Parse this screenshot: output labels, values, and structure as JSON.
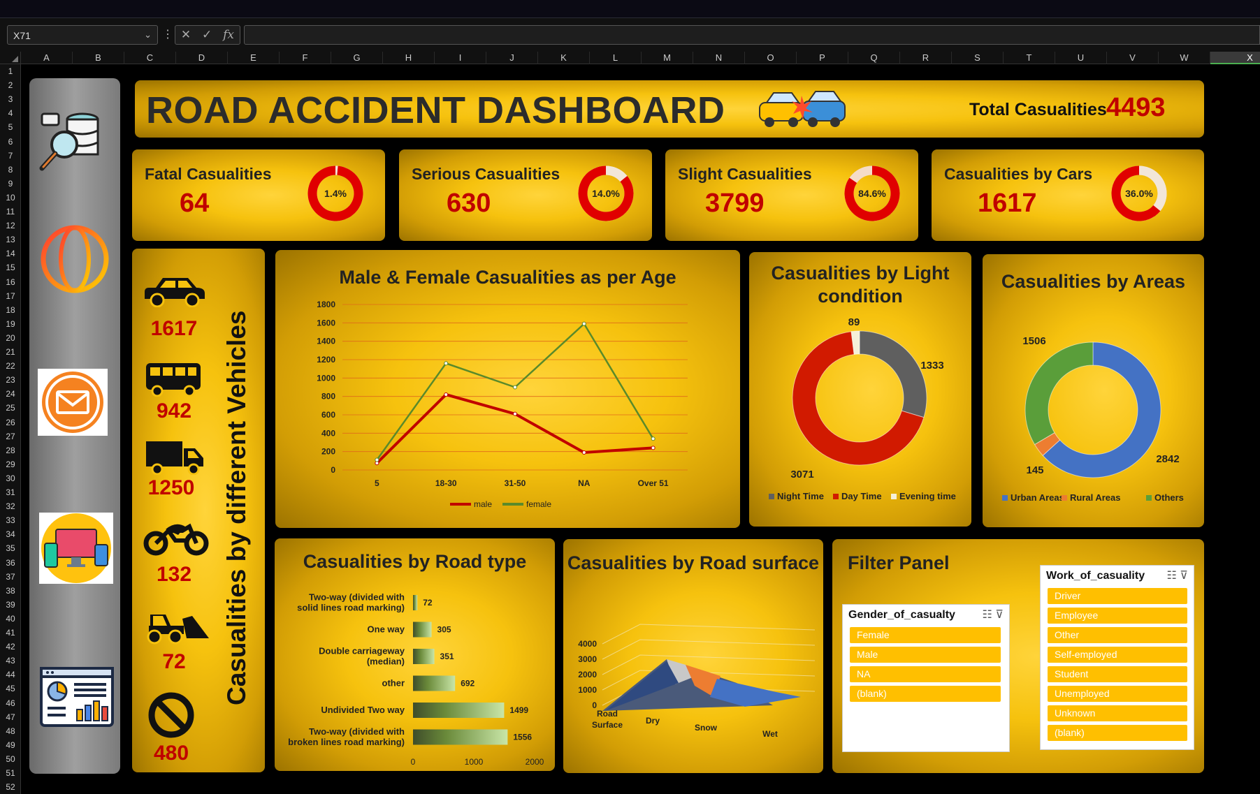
{
  "excel": {
    "name_box": "X71",
    "formula_icons": [
      "cancel-icon",
      "check-icon",
      "fx-icon"
    ],
    "columns": [
      "A",
      "B",
      "C",
      "D",
      "E",
      "F",
      "G",
      "H",
      "I",
      "J",
      "K",
      "L",
      "M",
      "N",
      "O",
      "P",
      "Q",
      "R",
      "S",
      "T",
      "U",
      "V",
      "W",
      "X"
    ],
    "selected_column": "X",
    "rows": [
      "1",
      "2",
      "3",
      "4",
      "5",
      "6",
      "7",
      "8",
      "9",
      "10",
      "11",
      "12",
      "13",
      "14",
      "15",
      "16",
      "17",
      "18",
      "19",
      "20",
      "21",
      "22",
      "23",
      "24",
      "25",
      "26",
      "27",
      "28",
      "29",
      "30",
      "31",
      "32",
      "33",
      "34",
      "35",
      "36",
      "37",
      "38",
      "39",
      "40",
      "41",
      "42",
      "43",
      "44",
      "45",
      "46",
      "47",
      "48",
      "49",
      "50",
      "51",
      "52"
    ]
  },
  "sidebar_icons": [
    "database-search-icon",
    "globe-icon",
    "mail-icon",
    "devices-icon",
    "dashboard-report-icon"
  ],
  "header": {
    "title": "ROAD ACCIDENT DASHBOARD",
    "total_label": "Total Casualities",
    "total_value": "4493"
  },
  "kpis": [
    {
      "label": "Fatal Casualities",
      "value": "64",
      "pct": "1.4%",
      "fraction": 0.014
    },
    {
      "label": "Serious Casualities",
      "value": "630",
      "pct": "14.0%",
      "fraction": 0.14
    },
    {
      "label": "Slight Casualities",
      "value": "3799",
      "pct": "84.6%",
      "fraction": 0.846
    },
    {
      "label": "Casualities by Cars",
      "value": "1617",
      "pct": "36.0%",
      "fraction": 0.36
    }
  ],
  "vehicles": {
    "title": "Casualities by different Vehicles",
    "items": [
      {
        "icon": "car-icon",
        "value": "1617"
      },
      {
        "icon": "bus-icon",
        "value": "942"
      },
      {
        "icon": "truck-icon",
        "value": "1250"
      },
      {
        "icon": "motorcycle-icon",
        "value": "132"
      },
      {
        "icon": "tractor-icon",
        "value": "72"
      },
      {
        "icon": "prohibited-icon",
        "value": "480"
      }
    ]
  },
  "age_chart_title": "Male & Female Casualities as per Age",
  "light_chart_title": "Casualities by Light condition",
  "area_chart_title": "Casualities by Areas",
  "roadtype_chart_title": "Casualities by Road type",
  "surface_chart_title": "Casualities by Road surface",
  "chart_data": [
    {
      "type": "line",
      "title": "Male & Female Casualities as per Age",
      "categories": [
        "5",
        "18-30",
        "31-50",
        "NA",
        "Over 51"
      ],
      "series": [
        {
          "name": "male",
          "values": [
            75,
            820,
            610,
            190,
            240
          ],
          "color": "#c00000"
        },
        {
          "name": "female",
          "values": [
            110,
            1160,
            900,
            1590,
            340
          ],
          "color": "#5a8a2a"
        }
      ],
      "yticks": [
        "0",
        "200",
        "400",
        "600",
        "800",
        "1000",
        "1200",
        "1400",
        "1600",
        "1800"
      ],
      "ylim": [
        0,
        1800
      ]
    },
    {
      "type": "pie",
      "title": "Casualities by Light condition",
      "labels": [
        "Night Time",
        "Day Time",
        "Evening time"
      ],
      "values": [
        1333,
        3071,
        89
      ],
      "value_labels": [
        "1333",
        "3071",
        "89"
      ],
      "colors": [
        "#5f5f5f",
        "#d11a00",
        "#f5f0d8"
      ]
    },
    {
      "type": "pie",
      "title": "Casualities by Areas",
      "labels": [
        "Urban Areas",
        "Rural Areas",
        "Others"
      ],
      "values": [
        2842,
        145,
        1506
      ],
      "value_labels": [
        "2842",
        "145",
        "1506"
      ],
      "colors": [
        "#4472c4",
        "#ed7d31",
        "#5a9e3a"
      ]
    },
    {
      "type": "bar",
      "title": "Casualities by Road type",
      "categories": [
        [
          "Two-way (divided with",
          "solid lines road marking)"
        ],
        [
          "One way"
        ],
        [
          "Double carriageway",
          "(median)"
        ],
        [
          "other"
        ],
        [
          "Undivided Two way"
        ],
        [
          "Two-way (divided with",
          "broken lines road marking)"
        ]
      ],
      "values": [
        72,
        305,
        351,
        692,
        1499,
        1556
      ],
      "value_labels": [
        "72",
        "305",
        "351",
        "692",
        "1499",
        "1556"
      ],
      "xticks": [
        "0",
        "1000",
        "2000"
      ],
      "xlim": [
        0,
        2000
      ]
    },
    {
      "type": "area",
      "title": "Casualities by Road surface",
      "categories": [
        "Road Surface",
        "Dry",
        "Snow",
        "Wet"
      ],
      "yticks": [
        "0",
        "1000",
        "2000",
        "3000",
        "4000"
      ],
      "ylim": [
        0,
        4000
      ]
    }
  ],
  "filter_panel": {
    "title": "Filter Panel",
    "gender_slicer": {
      "header": "Gender_of_casualty",
      "items": [
        "Female",
        "Male",
        "NA",
        "(blank)"
      ]
    },
    "work_slicer": {
      "header": "Work_of_casuality",
      "items": [
        "Driver",
        "Employee",
        "Other",
        "Self-employed",
        "Student",
        "Unemployed",
        "Unknown",
        "(blank)"
      ]
    }
  }
}
